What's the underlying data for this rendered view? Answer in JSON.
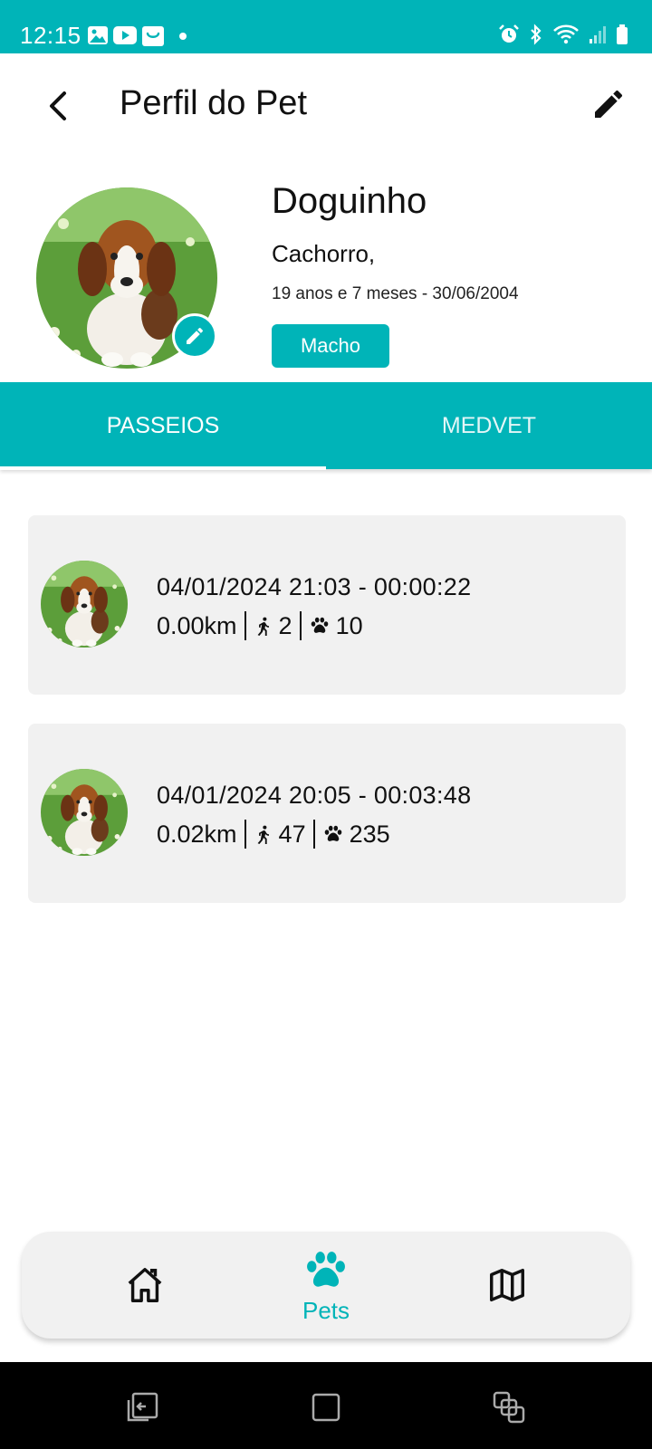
{
  "status_bar": {
    "time": "12:15",
    "left_icons": [
      "image-icon",
      "youtube-icon",
      "shopping-bag-icon",
      "dot-icon"
    ],
    "right_icons": [
      "alarm-icon",
      "bluetooth-icon",
      "wifi-icon",
      "signal-icon",
      "battery-icon"
    ],
    "background": "#00b4b8"
  },
  "header": {
    "title": "Perfil do Pet",
    "back_icon": "back-arrow-icon",
    "edit_icon": "pencil-icon"
  },
  "pet": {
    "name": "Doguinho",
    "species": "Cachorro,",
    "age": "19 anos e 7 meses - 30/06/2004",
    "sex": "Macho"
  },
  "tabs": [
    {
      "label": "PASSEIOS",
      "active": true
    },
    {
      "label": "MEDVET",
      "active": false
    }
  ],
  "walks": [
    {
      "datetime": "04/01/2024 21:03 - 00:00:22",
      "distance": "0.00km",
      "steps": "2",
      "paws": "10"
    },
    {
      "datetime": "04/01/2024 20:05 - 00:03:48",
      "distance": "0.02km",
      "steps": "47",
      "paws": "235"
    }
  ],
  "bottom_nav": {
    "items": [
      {
        "icon": "home-icon",
        "label": ""
      },
      {
        "icon": "paw-icon",
        "label": "Pets",
        "active": true
      },
      {
        "icon": "map-icon",
        "label": ""
      }
    ]
  },
  "colors": {
    "accent": "#00b4b8",
    "card_bg": "#f1f1f1"
  }
}
